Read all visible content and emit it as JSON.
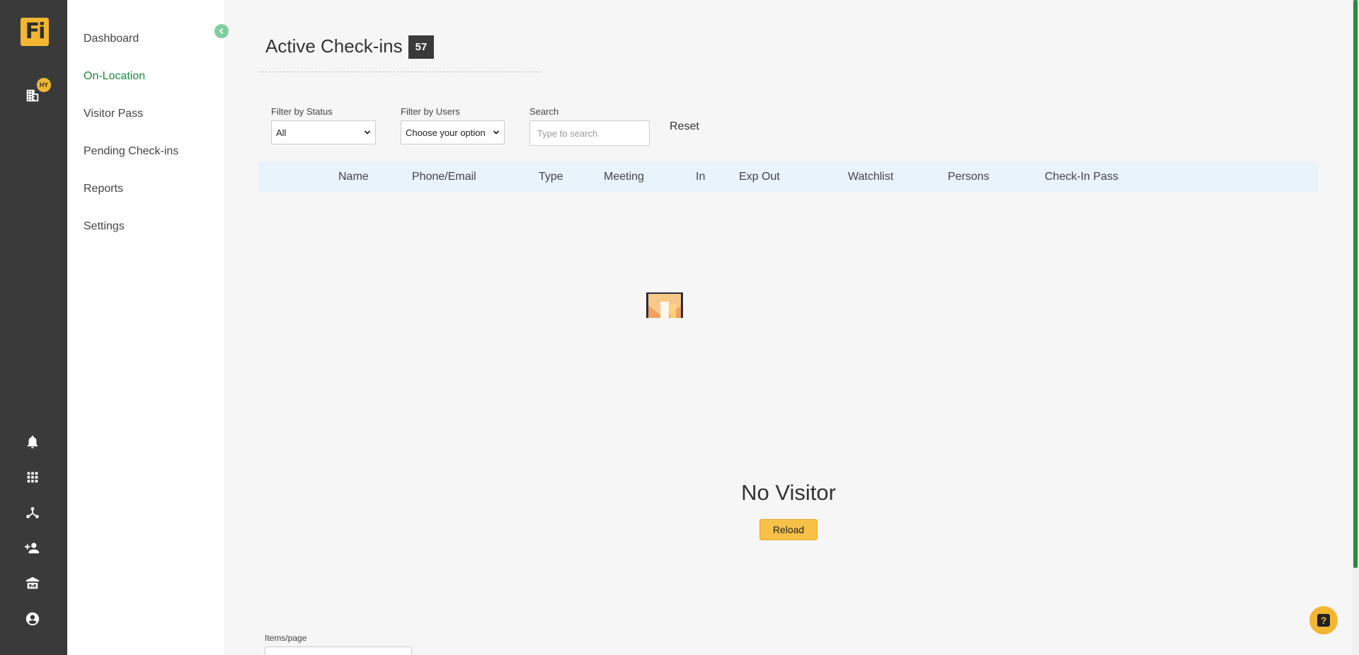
{
  "brand": {
    "logo_text": "Fi",
    "accent": "#f2b631"
  },
  "rail": {
    "badge": "HY",
    "icons": [
      "building-icon",
      "bell-icon",
      "grid-icon",
      "network-icon",
      "add-person-icon",
      "institution-icon",
      "account-icon"
    ]
  },
  "nav": {
    "items": [
      {
        "label": "Dashboard"
      },
      {
        "label": "On-Location"
      },
      {
        "label": "Visitor Pass"
      },
      {
        "label": "Pending Check-ins"
      },
      {
        "label": "Reports"
      },
      {
        "label": "Settings"
      }
    ],
    "active_color": "#1d8a3c"
  },
  "page": {
    "title": "Active Check-ins",
    "count": "57"
  },
  "filters": {
    "status_label": "Filter by Status",
    "status_value": "All",
    "users_label": "Filter by Users",
    "users_value": "Choose your option",
    "search_label": "Search",
    "search_placeholder": "Type to search",
    "reset_label": "Reset"
  },
  "table": {
    "columns": [
      "Name",
      "Phone/Email",
      "Type",
      "Meeting",
      "In",
      "Exp Out",
      "Watchlist",
      "Persons",
      "Check-In Pass"
    ],
    "header_bg": "#e8f3fc"
  },
  "empty_state": {
    "message": "No Visitor",
    "reload_label": "Reload"
  },
  "pagination": {
    "items_label": "Items/page"
  }
}
